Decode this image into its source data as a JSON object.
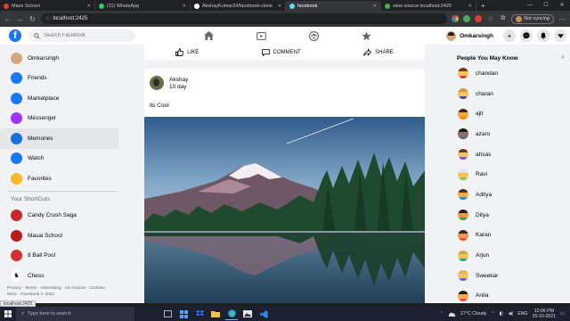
{
  "browser": {
    "tabs": [
      {
        "label": "Maze School",
        "color": "#e53935",
        "active": false
      },
      {
        "label": "(11) WhatsApp",
        "color": "#25d366",
        "active": false
      },
      {
        "label": "AkshayKumar24/facebook-clone",
        "color": "#ffffff",
        "active": false
      },
      {
        "label": "facebook",
        "color": "#61dafb",
        "active": true
      },
      {
        "label": "view source:localhost:2425",
        "color": "#4caf50",
        "active": false
      }
    ],
    "url": "localhost:2425",
    "sync_label": "Not syncing",
    "status_url": "localhost:2425"
  },
  "header": {
    "logo": "f",
    "search_placeholder": "Search Facebook",
    "profile_name": "Omkarsingh"
  },
  "left_sidebar": {
    "items": [
      {
        "label": "Omkarsingh",
        "icon": "avatar-icon",
        "color": "#d9a679"
      },
      {
        "label": "Friends",
        "icon": "friends-icon",
        "color": "#1877f2"
      },
      {
        "label": "Marketplace",
        "icon": "marketplace-icon",
        "color": "#1877f2"
      },
      {
        "label": "Messenger",
        "icon": "messenger-icon",
        "color": "#a033ff"
      },
      {
        "label": "Memories",
        "icon": "memories-icon",
        "color": "#1a6fd9"
      },
      {
        "label": "Watch",
        "icon": "watch-icon",
        "color": "#1877f2"
      },
      {
        "label": "Favorites",
        "icon": "favorites-icon",
        "color": "#f7b928"
      }
    ],
    "selected_index": 4,
    "shortcuts_title": "Your ShortCuts",
    "shortcuts": [
      {
        "label": "Candy Crush Saga",
        "icon": "candy-crush-icon",
        "color": "#c62828"
      },
      {
        "label": "Masai School",
        "icon": "masai-school-icon",
        "color": "#b71c1c"
      },
      {
        "label": "8 Ball Pool",
        "icon": "8-ball-icon",
        "color": "#d32f2f"
      },
      {
        "label": "Chess",
        "icon": "chess-icon",
        "color": "#ffffff"
      }
    ],
    "footer": "Privacy · Terms · Advertising · Ad choices · Cookies · More · Facebook © 2021"
  },
  "feed": {
    "actions": {
      "like": "LIKE",
      "comment": "COMMENT",
      "share": "SHARE"
    },
    "post": {
      "author": "Akshay",
      "time": "10 day",
      "text": "its Cool"
    }
  },
  "right_sidebar": {
    "title": "People You May Know",
    "people": [
      {
        "name": "chandan",
        "hair": "#6d3b1e",
        "skin": "#f7c35a",
        "shirt": "#e53935"
      },
      {
        "name": "charan",
        "hair": "#c99b4b",
        "skin": "#f7c35a",
        "shirt": "#3949ab"
      },
      {
        "name": "ajit",
        "hair": "#3e2723",
        "skin": "#f4a83b",
        "shirt": "#fb8c00"
      },
      {
        "name": "azaro",
        "hair": "#1c1c1c",
        "skin": "#8d6e63",
        "shirt": "#546e7a"
      },
      {
        "name": "ahsas",
        "hair": "#5d4037",
        "skin": "#f7c35a",
        "shirt": "#7e57c2"
      },
      {
        "name": "Ravi",
        "hair": "#e0e0e0",
        "skin": "#f7c35a",
        "shirt": "#8bc34a"
      },
      {
        "name": "Aditya",
        "hair": "#4e342e",
        "skin": "#f2b04a",
        "shirt": "#1e88e5"
      },
      {
        "name": "Ditya",
        "hair": "#212121",
        "skin": "#e59a50",
        "shirt": "#43a047"
      },
      {
        "name": "Karan",
        "hair": "#3e2723",
        "skin": "#e59a50",
        "shirt": "#f4511e"
      },
      {
        "name": "Arjun",
        "hair": "#d4a14a",
        "skin": "#f7c35a",
        "shirt": "#26a69a"
      },
      {
        "name": "Sweekar",
        "hair": "#d8b36a",
        "skin": "#f7c35a",
        "shirt": "#5c6bc0"
      },
      {
        "name": "Anila",
        "hair": "#2b1d14",
        "skin": "#f2b04a",
        "shirt": "#ec407a"
      }
    ]
  },
  "taskbar": {
    "search_placeholder": "Type here to search",
    "weather": "27°C  Cloudy",
    "language": "ENG",
    "time": "12:06 PM",
    "date": "15-10-2021"
  }
}
